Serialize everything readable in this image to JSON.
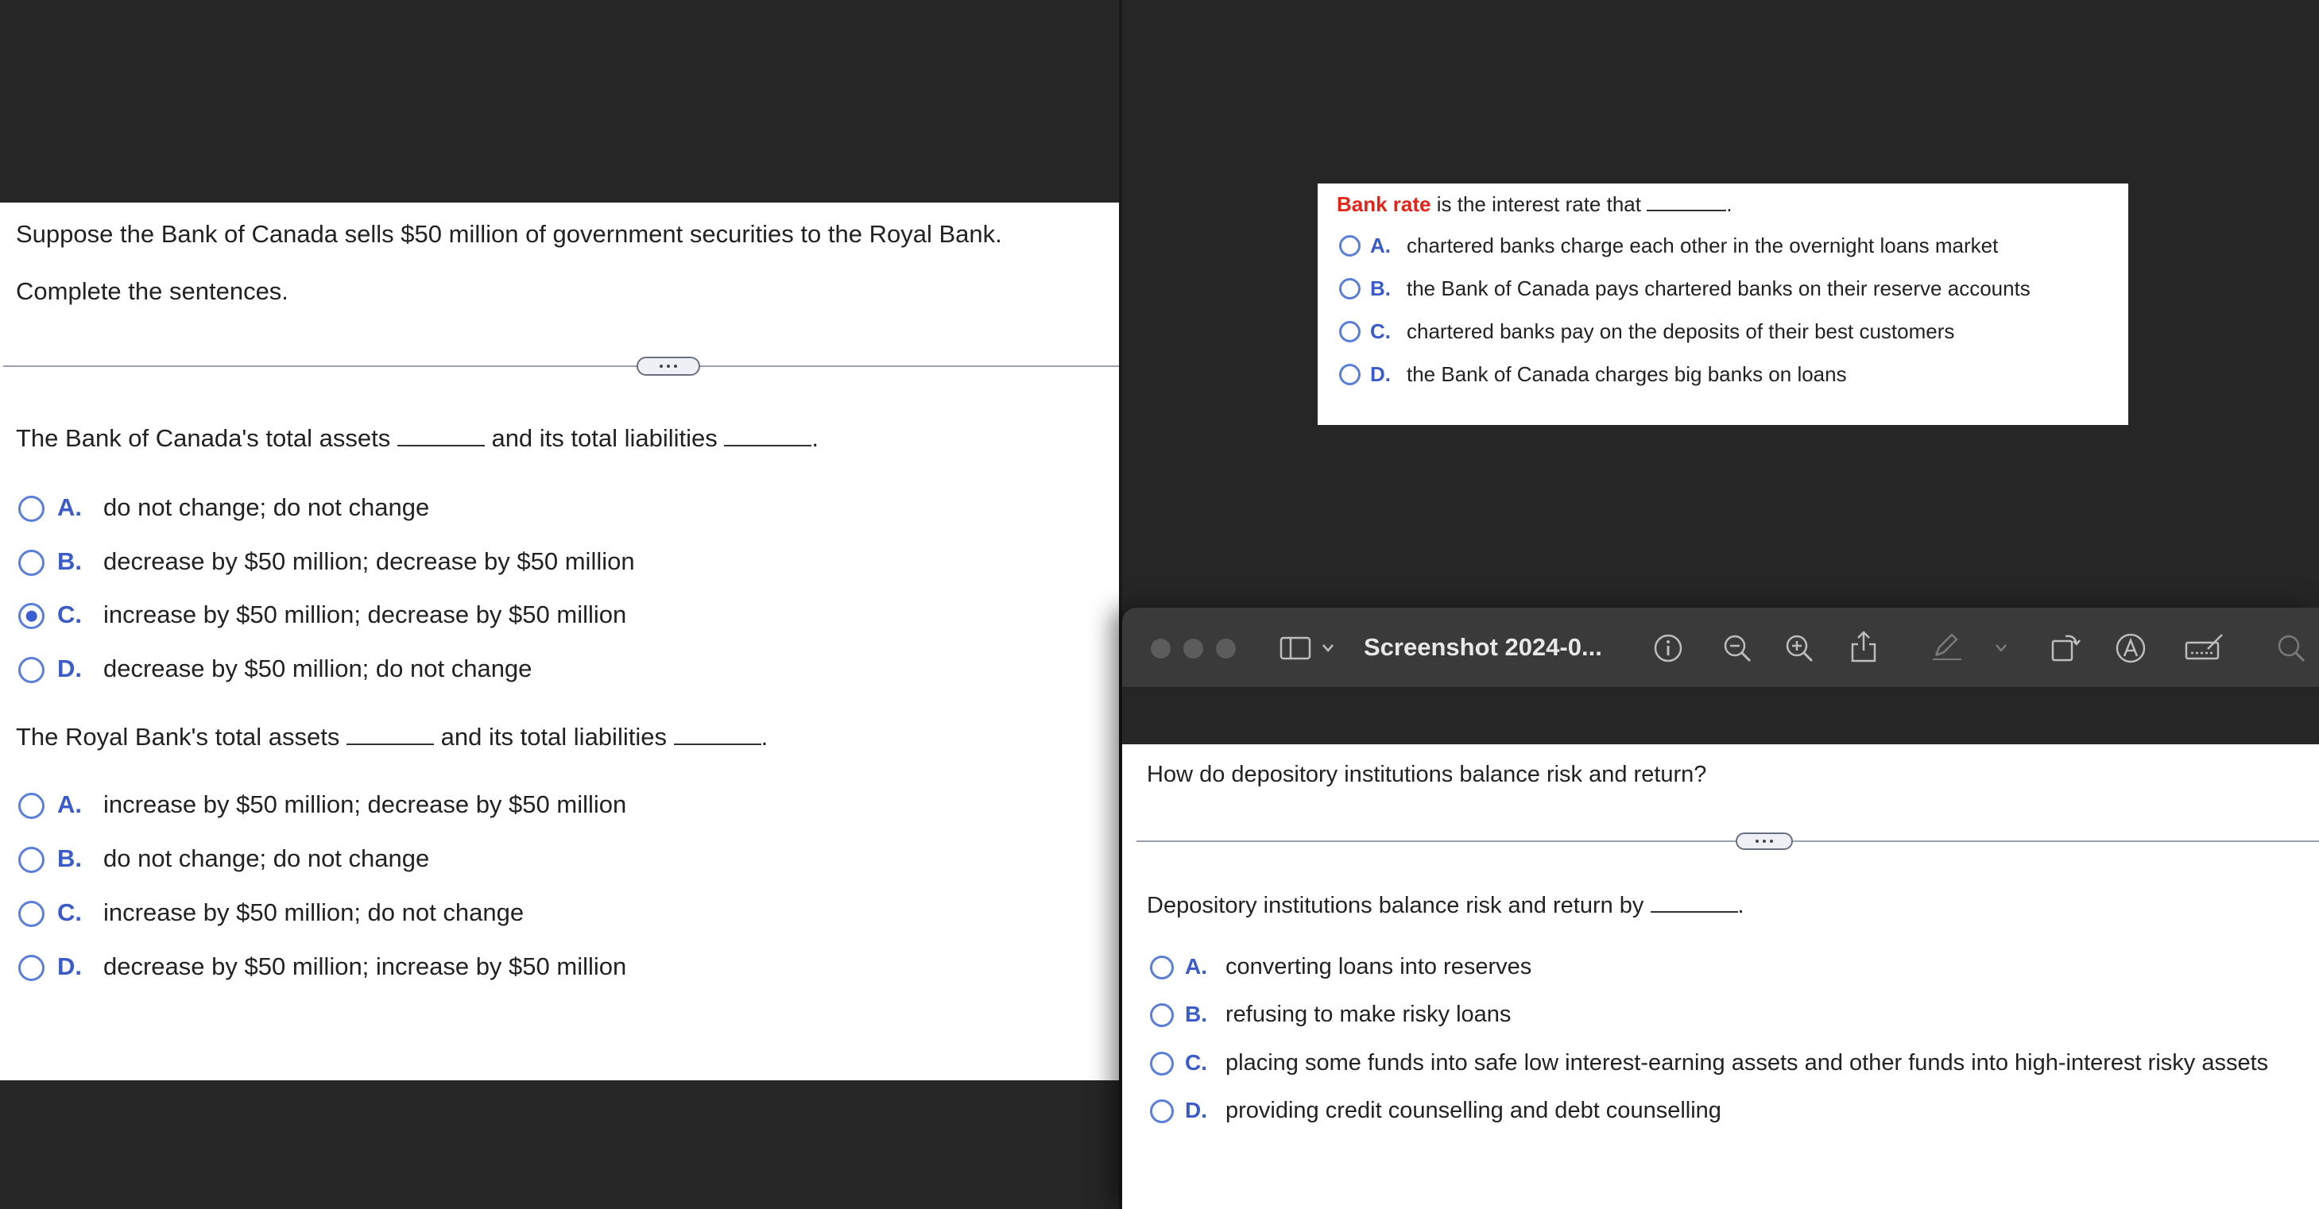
{
  "left": {
    "prompt": "Suppose the Bank of Canada sells $50 million of government securities to the Royal Bank.",
    "instruction": "Complete the sentences.",
    "q1": {
      "part1": "The Bank of Canada's total assets",
      "part2": "and its total liabilities",
      "end": ".",
      "options": [
        {
          "letter": "A.",
          "text": "do not change; do not change"
        },
        {
          "letter": "B.",
          "text": "decrease by $50 million; decrease by $50 million"
        },
        {
          "letter": "C.",
          "text": "increase by $50 million; decrease by $50 million"
        },
        {
          "letter": "D.",
          "text": "decrease by $50 million; do not change"
        }
      ],
      "selected": "C"
    },
    "q2": {
      "part1": "The Royal Bank's total assets",
      "part2": "and its total liabilities",
      "end": ".",
      "options": [
        {
          "letter": "A.",
          "text": "increase by $50 million; decrease by $50 million"
        },
        {
          "letter": "B.",
          "text": "do not change; do not change"
        },
        {
          "letter": "C.",
          "text": "increase by $50 million; do not change"
        },
        {
          "letter": "D.",
          "text": "decrease by $50 million; increase by $50 million"
        }
      ]
    }
  },
  "top_right": {
    "term": "Bank rate",
    "stem": "is the interest rate that",
    "end": ".",
    "options": [
      {
        "letter": "A.",
        "text": "chartered banks charge each other in the overnight loans market"
      },
      {
        "letter": "B.",
        "text": "the Bank of Canada pays chartered banks on their reserve accounts"
      },
      {
        "letter": "C.",
        "text": "chartered banks pay on the deposits of their best customers"
      },
      {
        "letter": "D.",
        "text": "the Bank of Canada charges big banks on loans"
      }
    ]
  },
  "preview_window": {
    "title": "Screenshot 2024-0...",
    "icons": [
      "sidebar-icon",
      "chevron-down-icon",
      "info-icon",
      "zoom-out-icon",
      "zoom-in-icon",
      "share-icon",
      "markup-pen-icon",
      "chevron-down-icon",
      "rotate-icon",
      "markup-icon",
      "form-fill-icon",
      "search-icon"
    ],
    "question": "How do depository institutions balance risk and return?",
    "stem": "Depository institutions balance risk and return by",
    "end": ".",
    "options": [
      {
        "letter": "A.",
        "text": "converting loans into reserves"
      },
      {
        "letter": "B.",
        "text": "refusing to make risky loans"
      },
      {
        "letter": "C.",
        "text": "placing some funds into safe low interest-earning assets and other funds into high-interest risky assets"
      },
      {
        "letter": "D.",
        "text": "providing credit counselling and debt counselling"
      }
    ]
  },
  "colors": {
    "accent_blue": "#3b5bc9",
    "term_red": "#e0261b",
    "dark_bg": "#262626",
    "toolbar_bg": "#3a3a3a"
  }
}
